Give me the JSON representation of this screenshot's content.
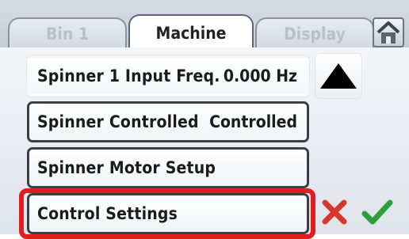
{
  "tabs": [
    {
      "label": "Bin 1",
      "state": "inactive"
    },
    {
      "label": "Machine",
      "state": "active"
    },
    {
      "label": "Display",
      "state": "inactive"
    }
  ],
  "home_icon": "home-icon",
  "rows": [
    {
      "label": "Spinner 1 Input Freq.",
      "value": "0.000 Hz"
    },
    {
      "label": "Spinner Controlled",
      "value": "Controlled"
    },
    {
      "label": "Spinner Motor Setup",
      "value": ""
    },
    {
      "label": "Control Settings",
      "value": ""
    }
  ],
  "scroll_up_icon": "triangle-up-icon",
  "cancel_icon": "red-x-icon",
  "confirm_icon": "green-check-icon",
  "colors": {
    "highlight": "#e11d1d",
    "cancel": "#d9362c",
    "confirm": "#2f9e3a"
  }
}
